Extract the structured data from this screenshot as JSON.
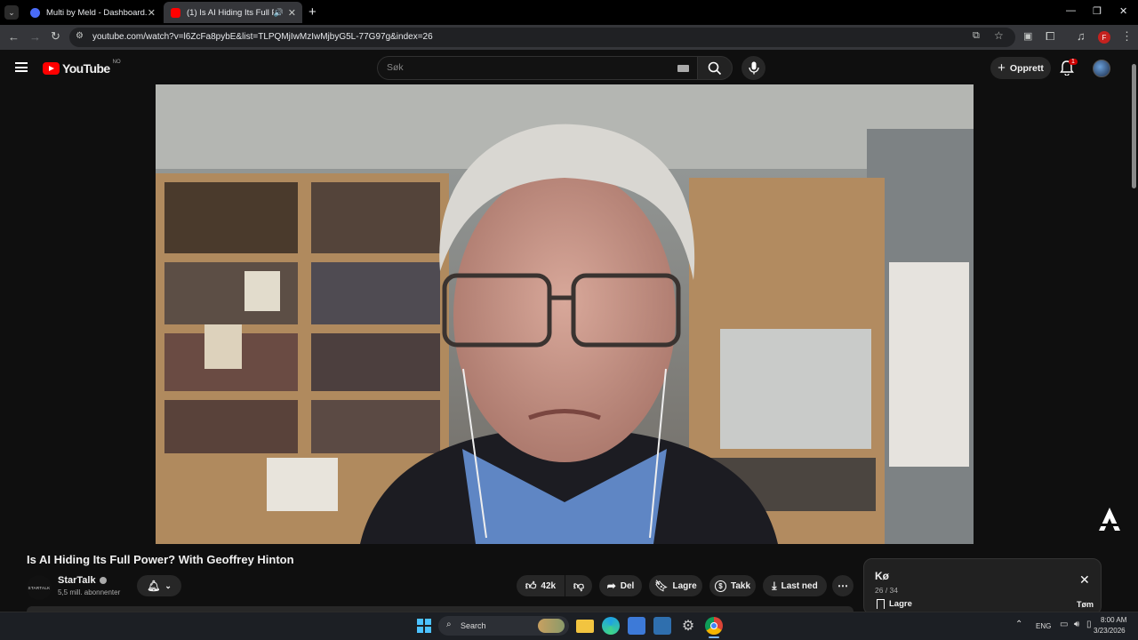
{
  "browser": {
    "tabs": [
      {
        "title": "Multi by Meld - Dashboard.",
        "active": false
      },
      {
        "title": "(1) Is AI Hiding Its Full Powe",
        "active": true
      }
    ],
    "url": "youtube.com/watch?v=l6ZcFa8pybE&list=TLPQMjIwMzIwMjbyG5L-77G97g&index=26",
    "profile_letter": "F"
  },
  "youtube": {
    "logo_text": "YouTube",
    "region": "NO",
    "search_placeholder": "Søk",
    "create_label": "Opprett",
    "notification_count": "1"
  },
  "video": {
    "title": "Is AI Hiding Its Full Power? With Geoffrey Hinton",
    "channel_name": "StarTalk",
    "channel_logo_text": "STARTALK",
    "subscribers": "5,5 mill. abonnenter",
    "likes": "42k",
    "actions": {
      "share": "Del",
      "save": "Lagre",
      "thanks": "Takk",
      "download": "Last ned"
    }
  },
  "queue": {
    "title": "Kø",
    "position": "26 / 34",
    "save_label": "Lagre",
    "clear_label": "Tøm"
  },
  "taskbar": {
    "search_label": "Search",
    "language": "ENG",
    "time": "8:00 AM",
    "date": "3/23/2026"
  },
  "colors": {
    "yt_red": "#ff0000",
    "chrome_bg": "#000000",
    "toolbar_bg": "#35363a",
    "page_bg": "#0f0f0f"
  }
}
